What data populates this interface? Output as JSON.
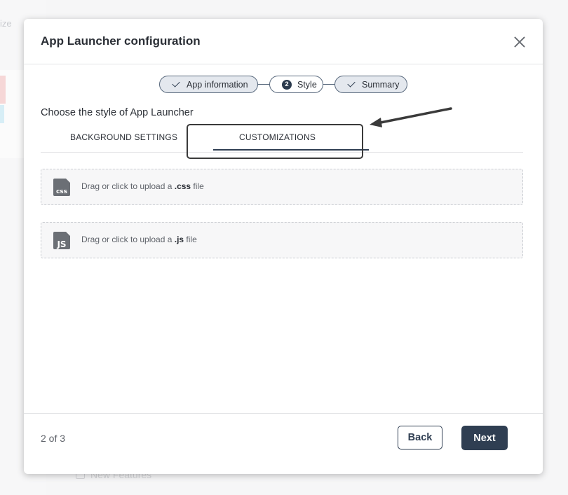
{
  "background": {
    "left_text": "ize",
    "bottom_text": "New Features"
  },
  "modal": {
    "title": "App Launcher configuration",
    "subtitle": "Choose the style of App Launcher",
    "steps": [
      {
        "label": "App information",
        "state": "done"
      },
      {
        "label": "Style",
        "state": "current",
        "number": "2"
      },
      {
        "label": "Summary",
        "state": "done"
      }
    ],
    "tabs": [
      {
        "label": "BACKGROUND SETTINGS",
        "active": false
      },
      {
        "label": "CUSTOMIZATIONS",
        "active": true
      }
    ],
    "uploads": [
      {
        "icon": "css-file-icon",
        "icon_text": "css",
        "prefix": "Drag or click to upload a ",
        "ext": ".css",
        "suffix": " file"
      },
      {
        "icon": "js-file-icon",
        "icon_text": "JS",
        "prefix": "Drag or click to upload a ",
        "ext": ".js",
        "suffix": " file"
      }
    ],
    "footer": {
      "page_count": "2 of 3",
      "back_label": "Back",
      "next_label": "Next"
    }
  },
  "colors": {
    "primary": "#2f3e52",
    "step_done_bg": "#e4e8ee",
    "overlay_bg": "#f1f1f2"
  }
}
